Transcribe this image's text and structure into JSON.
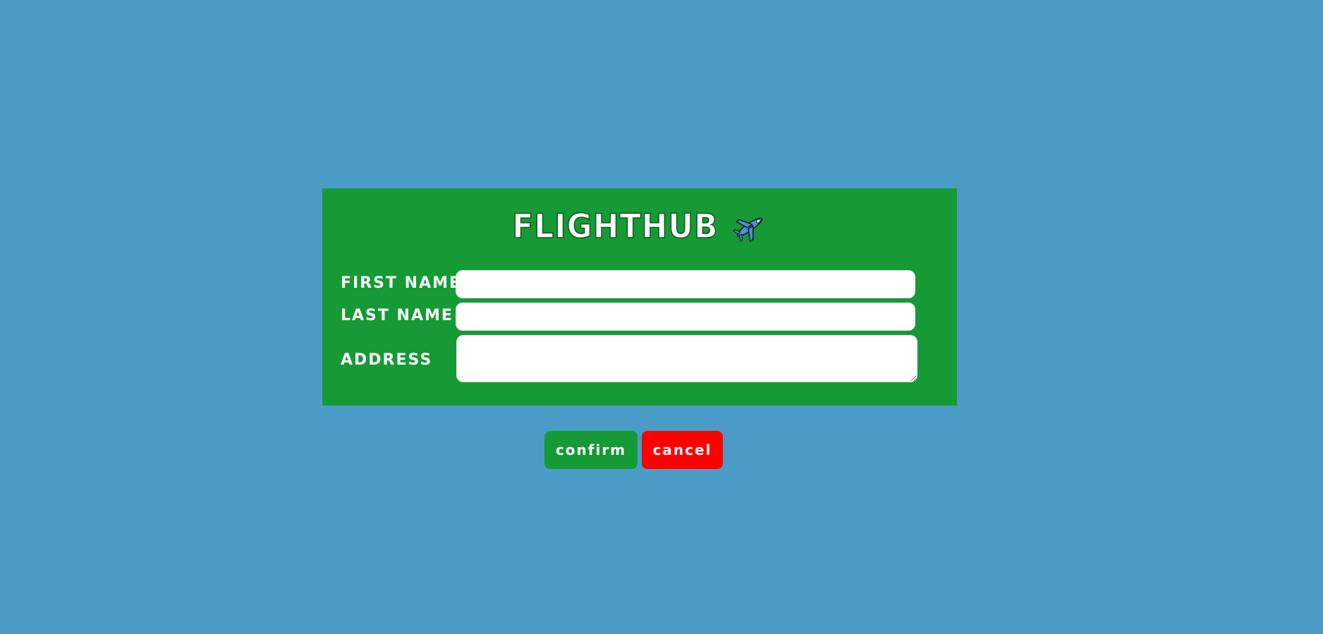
{
  "app": {
    "title": "FLIGHTHUB",
    "logo_icon": "airplane-icon"
  },
  "form": {
    "first_name_label": "FIRST NAME",
    "last_name_label": "LAST NAME",
    "address_label": "ADDRESS",
    "first_name_value": "",
    "last_name_value": "",
    "address_value": ""
  },
  "actions": {
    "confirm_label": "confirm",
    "cancel_label": "cancel"
  },
  "colors": {
    "background": "#4a9cc6",
    "card": "#169a35",
    "confirm": "#169a35",
    "cancel": "#ff0000"
  }
}
